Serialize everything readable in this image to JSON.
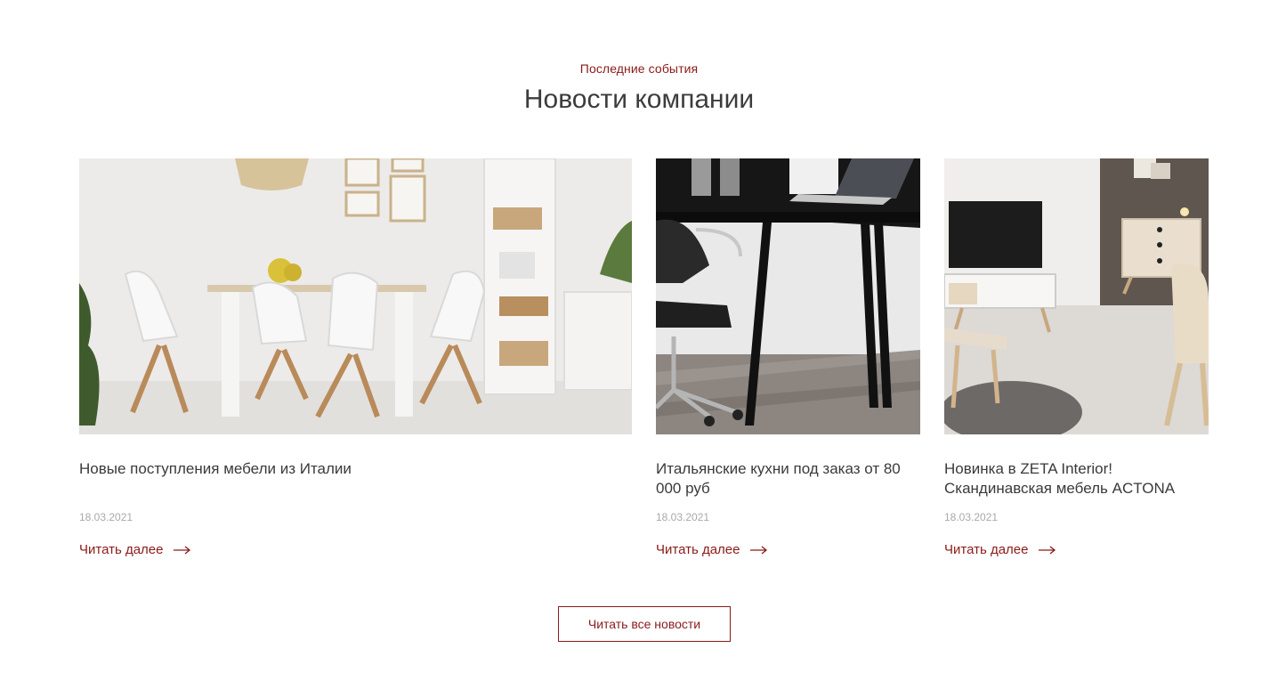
{
  "section": {
    "eyebrow": "Последние события",
    "title": "Новости компании"
  },
  "news": [
    {
      "title": "Новые поступления мебели из Италии",
      "date": "18.03.2021",
      "link_label": "Читать далее",
      "image": "dining-room-photo"
    },
    {
      "title": "Итальянские кухни под заказ от 80 000 руб",
      "date": "18.03.2021",
      "link_label": "Читать далее",
      "image": "office-desk-photo"
    },
    {
      "title": "Новинка в ZETA Interior! Скандинавская мебель ACTONA",
      "date": "18.03.2021",
      "link_label": "Читать далее",
      "image": "living-room-photo"
    }
  ],
  "all_news_button": "Читать все новости",
  "colors": {
    "accent": "#8b1a1a",
    "title": "#3c3c3c",
    "date": "#a9a9a9"
  }
}
